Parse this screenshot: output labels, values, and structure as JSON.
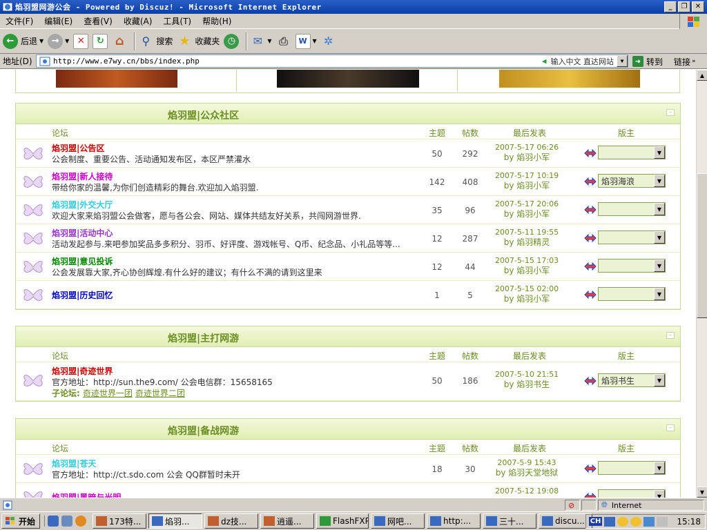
{
  "window": {
    "title": "焰羽盟网游公会 - Powered by Discuz! - Microsoft Internet Explorer"
  },
  "menu": [
    "文件(F)",
    "编辑(E)",
    "查看(V)",
    "收藏(A)",
    "工具(T)",
    "帮助(H)"
  ],
  "toolbar": {
    "back": "后退",
    "search": "搜索",
    "favorites": "收藏夹"
  },
  "address": {
    "label": "地址(D)",
    "url": "http://www.e7wy.cn/bbs/index.php",
    "hint": "输入中文 直达网站",
    "go": "转到",
    "links": "链接"
  },
  "column_headers": {
    "forum": "论坛",
    "topics": "主题",
    "posts": "帖数",
    "last_post": "最后发表",
    "moderator": "版主"
  },
  "sections": [
    {
      "title": "焰羽盟|公众社区",
      "forums": [
        {
          "name": "焰羽盟|公告区",
          "color": "#cc0000",
          "desc": "公会制度、重要公告、活动通知发布区，本区严禁灌水",
          "topics": "50",
          "posts": "292",
          "last_time": "2007-5-17 06:26",
          "last_by": "by 焰羽小军",
          "moderator": ""
        },
        {
          "name": "焰羽盟|新人接待",
          "color": "#cc00cc",
          "desc": "带给你家的温馨,为你们创造精彩的舞台.欢迎加入焰羽盟.",
          "topics": "142",
          "posts": "408",
          "last_time": "2007-5-17 10:19",
          "last_by": "by 焰羽小军",
          "moderator": "焰羽海浪"
        },
        {
          "name": "焰羽盟|外交大厅",
          "color": "#33ccdd",
          "desc": "欢迎大家来焰羽盟公会做客，愿与各公会、网站、媒体共结友好关系，共闯网游世界.",
          "topics": "35",
          "posts": "96",
          "last_time": "2007-5-17 20:06",
          "last_by": "by 焰羽小军",
          "moderator": ""
        },
        {
          "name": "焰羽盟|活动中心",
          "color": "#9933cc",
          "desc": "活动发起参与.来吧参加奖品多多积分、羽币、好评度、游戏帐号、Q币、纪念品、小礼品等等...",
          "topics": "12",
          "posts": "287",
          "last_time": "2007-5-11 19:55",
          "last_by": "by 焰羽精灵",
          "moderator": ""
        },
        {
          "name": "焰羽盟|意见投诉",
          "color": "#008800",
          "desc": "公会发展靠大家,齐心协创辉煌.有什么好的建议；有什么不满的请到这里来",
          "topics": "12",
          "posts": "44",
          "last_time": "2007-5-15 17:03",
          "last_by": "by 焰羽小军",
          "moderator": ""
        },
        {
          "name": "焰羽盟|历史回忆",
          "color": "#0000cc",
          "desc": "",
          "topics": "1",
          "posts": "5",
          "last_time": "2007-5-15 02:00",
          "last_by": "by 焰羽小军",
          "moderator": ""
        }
      ]
    },
    {
      "title": "焰羽盟|主打网游",
      "forums": [
        {
          "name": "焰羽盟|奇迹世界",
          "color": "#cc0000",
          "desc": "官方地址：http://sun.the9.com/ 公会电信群：15658165",
          "subforum_label": "子论坛:",
          "subforums": [
            "奇迹世界一团",
            "奇迹世界二团"
          ],
          "topics": "50",
          "posts": "186",
          "last_time": "2007-5-10 21:51",
          "last_by": "by 焰羽书生",
          "moderator": "焰羽书生"
        }
      ]
    },
    {
      "title": "焰羽盟|备战网游",
      "forums": [
        {
          "name": "焰羽盟|苍天",
          "color": "#33ccdd",
          "desc": "官方地址：http://ct.sdo.com 公会  QQ群暂时未开",
          "topics": "18",
          "posts": "30",
          "last_time": "2007-5-9 15:43",
          "last_by": "by 焰羽天堂地狱",
          "moderator": ""
        },
        {
          "name": "焰羽盟|黑暗与光明",
          "color": "#cc00cc",
          "desc": "",
          "topics": "",
          "posts": "",
          "last_time": "2007-5-12 19:08",
          "last_by": "",
          "moderator": ""
        }
      ]
    }
  ],
  "status": {
    "zone": "Internet"
  },
  "taskbar": {
    "start": "开始",
    "tasks": [
      "173特...",
      "焰羽...",
      "dz技...",
      "逍遥...",
      "FlashFXP",
      "网吧...",
      "http:...",
      "三十...",
      "discu..."
    ],
    "ime": "CH",
    "clock": "15:18"
  }
}
